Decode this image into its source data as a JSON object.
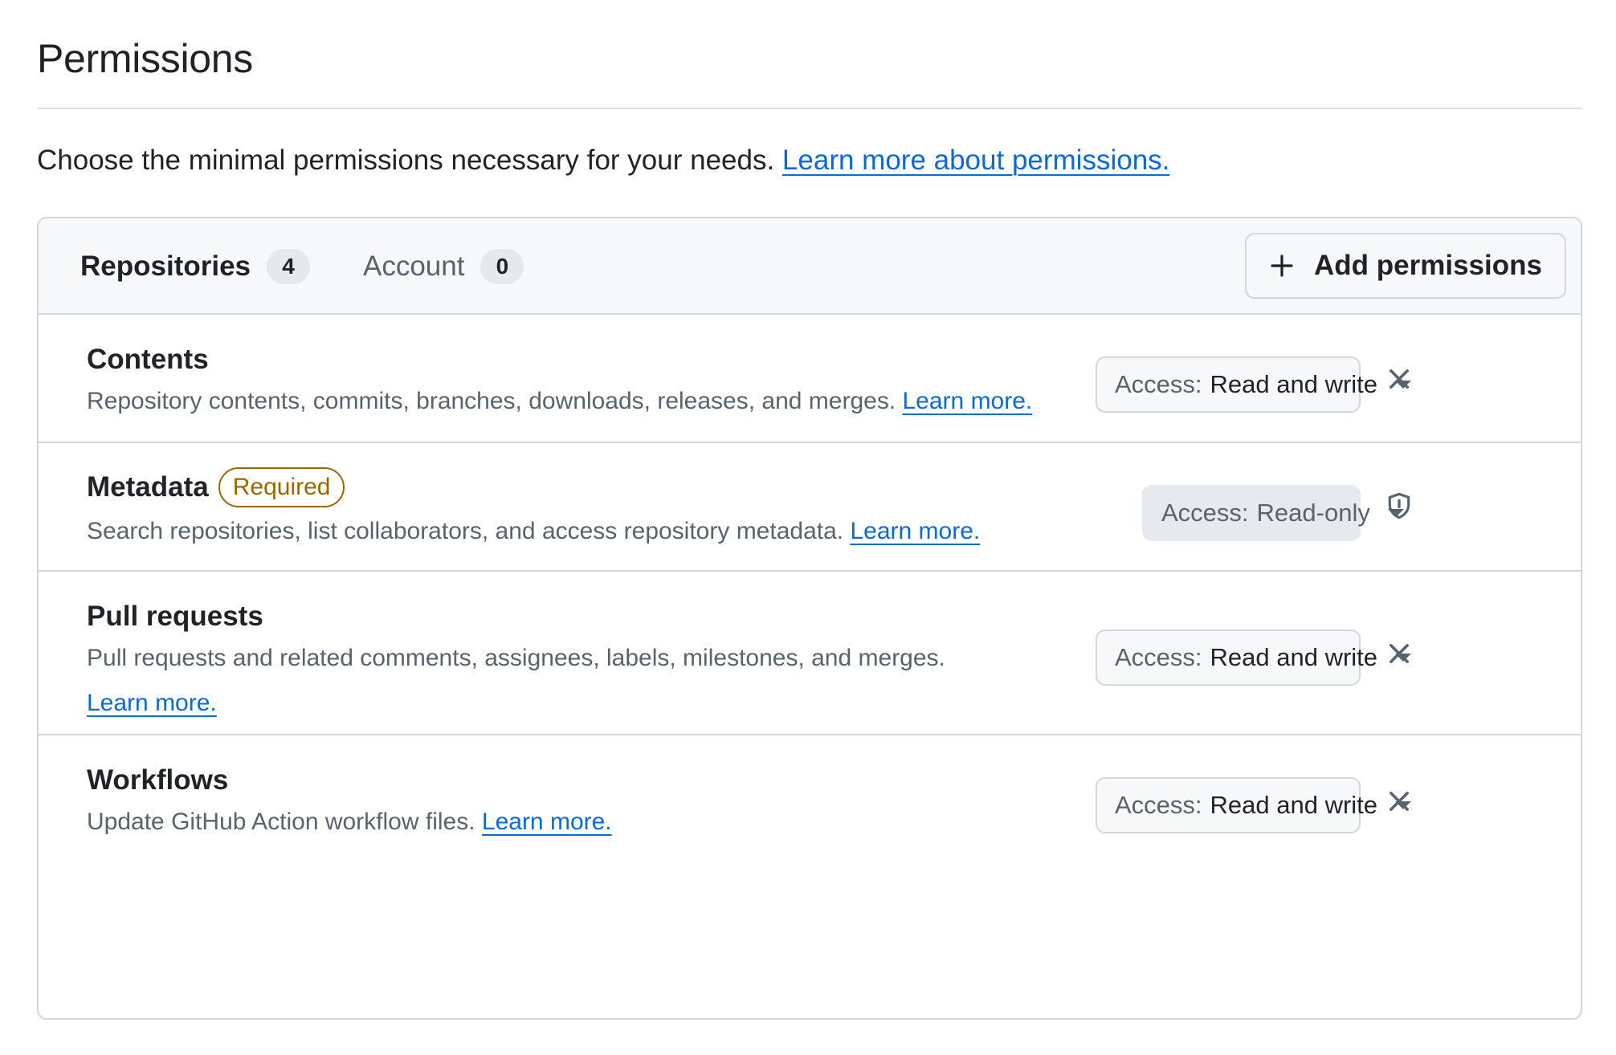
{
  "page": {
    "title": "Permissions",
    "intro_text": "Choose the minimal permissions necessary for your needs.",
    "intro_link": "Learn more about permissions."
  },
  "tabs": [
    {
      "label": "Repositories",
      "count": "4",
      "selected": true
    },
    {
      "label": "Account",
      "count": "0",
      "selected": false
    }
  ],
  "add_button": {
    "label": "Add permissions",
    "icon": "plus-icon"
  },
  "permissions": [
    {
      "title": "Contents",
      "description": "Repository contents, commits, branches, downloads, releases, and merges.",
      "link": "Learn more.",
      "access_label": "Access:",
      "access_value": "Read and write",
      "action_icon": "close-icon"
    },
    {
      "title": "Metadata",
      "badge": "Required",
      "description": "Search repositories, list collaborators, and access repository metadata.",
      "link": "Learn more.",
      "access_label": "Access:",
      "access_value": "Read-only",
      "action_icon": "shield-alert-icon"
    },
    {
      "title": "Pull requests",
      "description": "Pull requests and related comments, assignees, labels, milestones, and merges.",
      "link": "Learn more.",
      "access_label": "Access:",
      "access_value": "Read and write",
      "action_icon": "close-icon"
    },
    {
      "title": "Workflows",
      "description": "Update GitHub Action workflow files.",
      "link": "Learn more.",
      "access_label": "Access:",
      "access_value": "Read and write",
      "action_icon": "close-icon"
    }
  ],
  "colors": {
    "link": "#0969da",
    "required_badge": "#9a6700",
    "border": "#d0d7de",
    "header_bg": "#f6f8fa"
  }
}
